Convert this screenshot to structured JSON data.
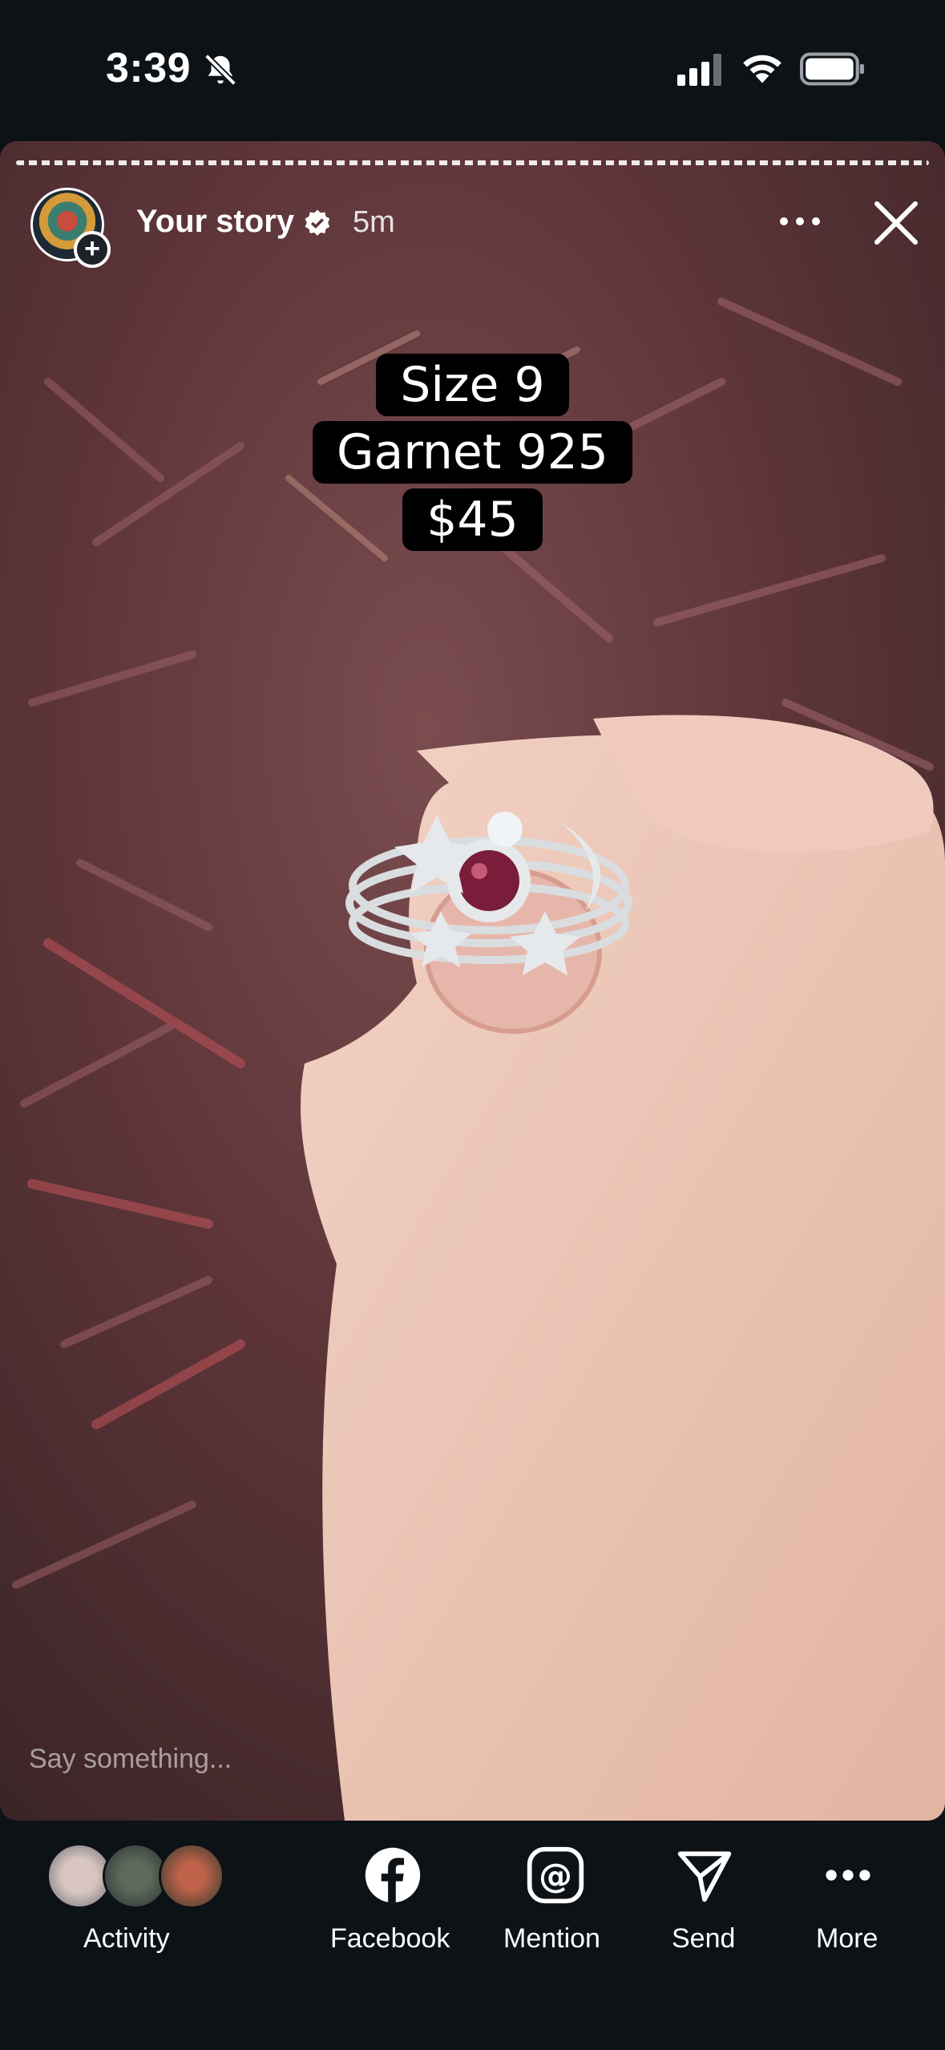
{
  "status_bar": {
    "time": "3:39"
  },
  "story": {
    "user": "Your story",
    "age": "5m",
    "caption_lines": [
      "Size 9",
      "Garnet 925",
      "$45"
    ],
    "reply_placeholder": "Say something..."
  },
  "bottom_bar": {
    "activity_label": "Activity",
    "facebook_label": "Facebook",
    "mention_label": "Mention",
    "send_label": "Send",
    "more_label": "More"
  },
  "colors": {
    "background": "#0d1216",
    "caption_box": "#000000"
  }
}
